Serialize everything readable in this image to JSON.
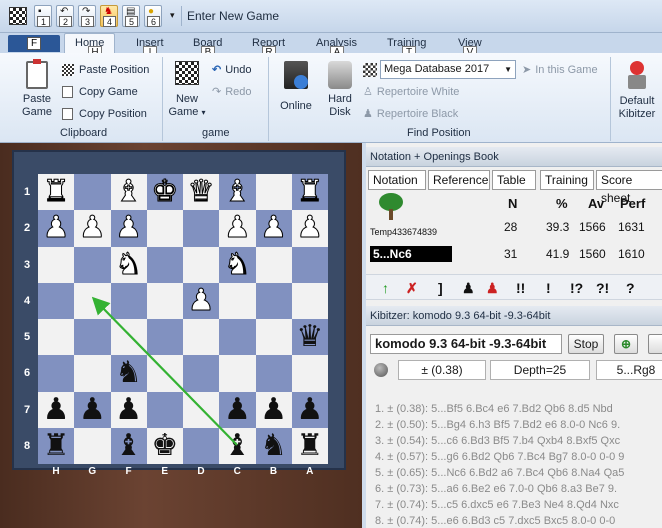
{
  "window": {
    "title": "Enter New Game",
    "qa_numbers": [
      "1",
      "2",
      "3",
      "4",
      "5",
      "6"
    ]
  },
  "tabs": {
    "file": "F",
    "home": "Home",
    "insert": "Insert",
    "board": "Board",
    "report": "Report",
    "analysis": "Analysis",
    "training": "Training",
    "view": "View"
  },
  "keytips": {
    "home": "H",
    "insert": "I",
    "board": "B",
    "report": "R",
    "analysis": "A",
    "training": "T",
    "view": "V"
  },
  "clipboard": {
    "paste_game_1": "Paste",
    "paste_game_2": "Game",
    "paste_position": "Paste Position",
    "copy_game": "Copy Game",
    "copy_position": "Copy Position",
    "label": "Clipboard"
  },
  "game": {
    "new_game_1": "New",
    "new_game_2": "Game",
    "undo": "Undo",
    "redo": "Redo",
    "label": "game"
  },
  "find": {
    "online": "Online",
    "hard_disk_1": "Hard",
    "hard_disk_2": "Disk",
    "database": "Mega Database 2017",
    "in_this_game": "In this Game",
    "repertoire_white": "Repertoire White",
    "repertoire_black": "Repertoire Black",
    "label": "Find Position"
  },
  "kibitzer_btn": {
    "l1": "Default",
    "l2": "Kibitzer"
  },
  "board": {
    "ranks": [
      "1",
      "2",
      "3",
      "4",
      "5",
      "6",
      "7",
      "8"
    ],
    "files": [
      "H",
      "G",
      "F",
      "E",
      "D",
      "C",
      "B",
      "A"
    ]
  },
  "notation": {
    "header": "Notation + Openings Book",
    "tabs": [
      "Notation",
      "Reference",
      "Table",
      "Training",
      "Score sheet"
    ],
    "cols": {
      "n": "N",
      "pct": "%",
      "av": "Av",
      "perf": "Perf"
    },
    "row1": {
      "name": "Temp433674839",
      "n": "28",
      "pct": "39.3",
      "av": "1566",
      "perf": "1631"
    },
    "row2": {
      "move": "5...Nc6",
      "n": "31",
      "pct": "41.9",
      "av": "1560",
      "perf": "1610"
    },
    "annotations": [
      "!!",
      "!",
      "!?",
      "?!",
      "?"
    ]
  },
  "kibitzer": {
    "header": "Kibitzer: komodo 9.3 64-bit -9.3-64bit",
    "engine": "komodo 9.3 64-bit -9.3-64bit",
    "stop": "Stop",
    "eval": "± (0.38)",
    "depth": "Depth=25",
    "best": "5...Rg8",
    "lines": [
      "1. ± (0.38): 5...Bf5 6.Bc4 e6 7.Bd2 Qb6 8.d5 Nbd",
      "2. ± (0.50): 5...Bg4 6.h3 Bf5 7.Bd2 e6 8.0-0 Nc6 9.",
      "3. ± (0.54): 5...c6 6.Bd3 Bf5 7.b4 Qxb4 8.Bxf5 Qxc",
      "4. ± (0.57): 5...g6 6.Bd2 Qb6 7.Bc4 Bg7 8.0-0 0-0 9",
      "5. ± (0.65): 5...Nc6 6.Bd2 a6 7.Bc4 Qb6 8.Na4 Qa5",
      "6. ± (0.73): 5...a6 6.Be2 e6 7.0-0 Qb6 8.a3 Be7 9.",
      "7. ± (0.74): 5...c5 6.dxc5 e6 7.Be3 Ne4 8.Qd4 Nxc",
      "8. ± (0.74): 5...e6 6.Bd3 c5 7.dxc5 Bxc5 8.0-0 0-0"
    ]
  },
  "colors": {
    "light_square": "#f2f2f2",
    "dark_square": "#8191c0",
    "arrow": "#34b233"
  }
}
